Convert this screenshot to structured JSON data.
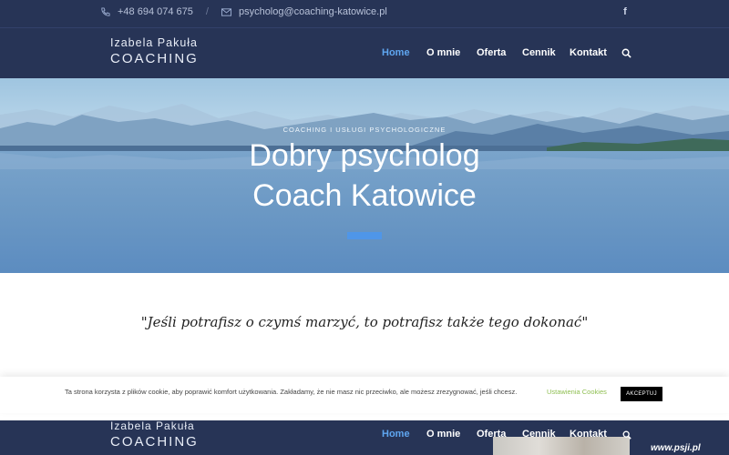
{
  "topbar": {
    "phone": "+48 694 074 675",
    "separator": "/",
    "email": "psycholog@coaching-katowice.pl",
    "facebook": "f"
  },
  "brand": {
    "line1": "Izabela Pakuła",
    "line2": "COACHING"
  },
  "nav": {
    "items": [
      {
        "label": "Home",
        "active": true
      },
      {
        "label": "O mnie",
        "active": false
      },
      {
        "label": "Oferta",
        "active": false
      },
      {
        "label": "Cennik",
        "active": false
      },
      {
        "label": "Kontakt",
        "active": false
      }
    ]
  },
  "hero": {
    "subtitle": "COACHING I USŁUGI PSYCHOLOGICZNE",
    "title_line1": "Dobry psycholog",
    "title_line2": "Coach Katowice"
  },
  "quote": "\"Jeśli potrafisz o czymś marzyć, to potrafisz także tego dokonać\"",
  "cookie": {
    "text": "Ta strona korzysta z plików cookie, aby poprawić komfort użytkowania. Zakładamy, że nie masz nic przeciwko, ale możesz zrezygnować, jeśli chcesz.",
    "settings": "Ustawienia Cookies",
    "accept": "AKCEPTUJ"
  },
  "watermark": "www.psji.pl",
  "colors": {
    "navy": "#273456",
    "accent": "#5fa6f0",
    "cookie_link": "#8fbf52"
  }
}
